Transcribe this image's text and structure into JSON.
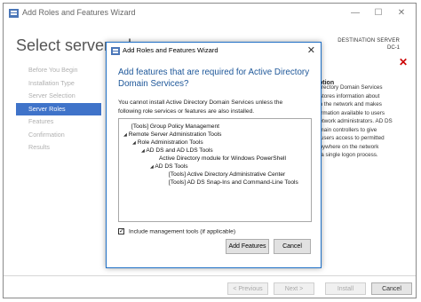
{
  "window": {
    "title": "Add Roles and Features Wizard",
    "min_glyph": "—",
    "max_glyph": "☐",
    "close_glyph": "✕"
  },
  "header": {
    "page_title": "Select server roles",
    "dest_label": "DESTINATION SERVER",
    "dest_name": "DC-1"
  },
  "nav": {
    "items": [
      {
        "label": "Before You Begin",
        "active": false
      },
      {
        "label": "Installation Type",
        "active": false
      },
      {
        "label": "Server Selection",
        "active": false
      },
      {
        "label": "Server Roles",
        "active": true
      },
      {
        "label": "Features",
        "active": false
      },
      {
        "label": "Confirmation",
        "active": false
      },
      {
        "label": "Results",
        "active": false
      }
    ]
  },
  "description": {
    "heading": "ption",
    "lines": [
      " Directory Domain Services",
      ") stores information about",
      " on the network and makes",
      "formation available to users",
      "network administrators. AD DS",
      "omain controllers to give",
      "k users access to permitted",
      "anywhere on the network",
      "h a single logon process."
    ]
  },
  "footer": {
    "prev_label": "< Previous",
    "next_label": "Next >",
    "install_label": "Install",
    "cancel_label": "Cancel"
  },
  "dialog": {
    "title": "Add Roles and Features Wizard",
    "close_glyph": "✕",
    "heading_line1": "Add features that are required for Active Directory",
    "heading_line2": "Domain Services?",
    "message_line1": "You cannot install Active Directory Domain Services unless the",
    "message_line2": "following role services or features are also installed.",
    "tree": [
      {
        "text": "[Tools] Group Policy Management",
        "expander": ""
      },
      {
        "text": "Remote Server Administration Tools",
        "expander": "◢"
      },
      {
        "text": "Role Administration Tools",
        "expander": "◢"
      },
      {
        "text": "AD DS and AD LDS Tools",
        "expander": "◢"
      },
      {
        "text": "Active Directory module for Windows PowerShell",
        "expander": ""
      },
      {
        "text": "AD DS Tools",
        "expander": "◢"
      },
      {
        "text": "[Tools] Active Directory Administrative Center",
        "expander": ""
      },
      {
        "text": "[Tools] AD DS Snap-Ins and Command-Line Tools",
        "expander": ""
      }
    ],
    "include_tools_label": "Include management tools (if applicable)",
    "include_tools_checked": true,
    "check_glyph": "✓",
    "add_features_label": "Add Features",
    "cancel_label": "Cancel"
  },
  "colors": {
    "accent": "#3f73c9",
    "heading_blue": "#1e5799",
    "dialog_border": "#1e6fc6",
    "error_red": "#cc0000"
  }
}
